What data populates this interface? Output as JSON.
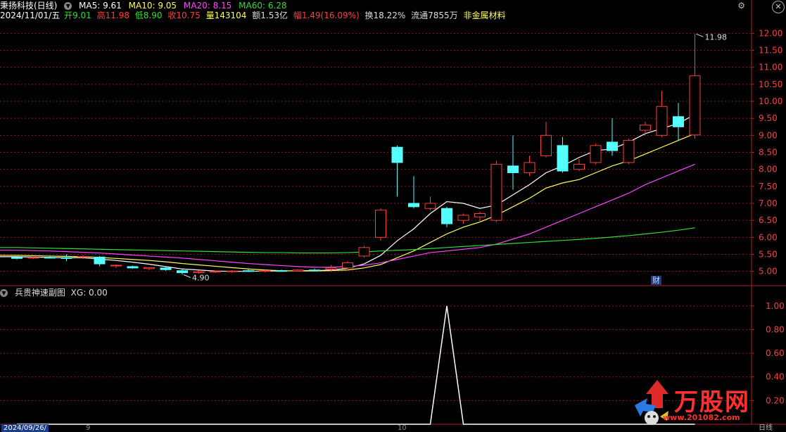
{
  "header": {
    "title": "秉扬科技(日线)",
    "ma": [
      {
        "label": "MA5: 9.61",
        "color": "#ffffff"
      },
      {
        "label": "MA10: 9.05",
        "color": "#ffff55"
      },
      {
        "label": "MA20: 8.15",
        "color": "#ff44ff"
      },
      {
        "label": "MA60: 6.28",
        "color": "#33dd33"
      }
    ]
  },
  "info": {
    "date": "2024/11/01/五",
    "open_label": "开",
    "open": "9.01",
    "high_label": "高",
    "high": "11.98",
    "low_label": "低",
    "low": "8.90",
    "close_label": "收",
    "close": "10.75",
    "vol_label": "量",
    "vol": "143104",
    "amt_label": "额",
    "amt": "1.53亿",
    "chg_label": "幅",
    "chg": "1.49(16.09%)",
    "turnover": "换18.22%",
    "float": "流通7855万",
    "sector": "非金属材料"
  },
  "sub": {
    "title": "兵贵神速副图",
    "xg": "XG: 0.00"
  },
  "badge": "财",
  "bottom": {
    "date": "2024/09/26/",
    "mark1": "9",
    "mark2": "10",
    "right": "日线"
  },
  "watermark": {
    "text": "万股网",
    "url": "www.201082.com"
  },
  "colors": {
    "up": "#ff3d3d",
    "down": "#54ffff",
    "ma5": "#ffffff",
    "ma10": "#ffff55",
    "ma20": "#ff44ff",
    "ma60": "#33dd33",
    "grid": "#8b1a1a"
  },
  "chart_data": [
    {
      "type": "candlestick",
      "title": "秉扬科技(日线)",
      "ylim": [
        4.6,
        12.4
      ],
      "y_ticks": [
        "12.00",
        "11.50",
        "11.00",
        "10.50",
        "10.00",
        "9.50",
        "9.00",
        "8.50",
        "8.00",
        "7.50",
        "7.00",
        "6.50",
        "6.00",
        "5.50",
        "5.00"
      ],
      "annotations": [
        {
          "text": "11.98",
          "value": 11.98
        },
        {
          "text": "4.90",
          "value": 4.9
        }
      ],
      "candles": [
        {
          "o": 5.41,
          "h": 5.45,
          "l": 5.35,
          "c": 5.38
        },
        {
          "o": 5.4,
          "h": 5.44,
          "l": 5.36,
          "c": 5.41
        },
        {
          "o": 5.41,
          "h": 5.46,
          "l": 5.38,
          "c": 5.4
        },
        {
          "o": 5.4,
          "h": 5.5,
          "l": 5.3,
          "c": 5.38
        },
        {
          "o": 5.42,
          "h": 5.48,
          "l": 5.36,
          "c": 5.44
        },
        {
          "o": 5.42,
          "h": 5.45,
          "l": 5.15,
          "c": 5.22
        },
        {
          "o": 5.16,
          "h": 5.2,
          "l": 5.1,
          "c": 5.18
        },
        {
          "o": 5.14,
          "h": 5.17,
          "l": 5.08,
          "c": 5.1
        },
        {
          "o": 5.08,
          "h": 5.12,
          "l": 5.04,
          "c": 5.11
        },
        {
          "o": 5.1,
          "h": 5.12,
          "l": 5.02,
          "c": 5.05
        },
        {
          "o": 5.02,
          "h": 5.06,
          "l": 4.9,
          "c": 4.96
        },
        {
          "o": 4.96,
          "h": 5.02,
          "l": 4.93,
          "c": 4.99
        },
        {
          "o": 4.99,
          "h": 5.02,
          "l": 4.95,
          "c": 5.0
        },
        {
          "o": 5.0,
          "h": 5.03,
          "l": 4.96,
          "c": 5.01
        },
        {
          "o": 5.02,
          "h": 5.06,
          "l": 4.98,
          "c": 5.0
        },
        {
          "o": 5.0,
          "h": 5.04,
          "l": 4.97,
          "c": 5.02
        },
        {
          "o": 5.02,
          "h": 5.05,
          "l": 4.99,
          "c": 5.01
        },
        {
          "o": 5.01,
          "h": 5.06,
          "l": 4.99,
          "c": 5.04
        },
        {
          "o": 5.04,
          "h": 5.08,
          "l": 5.0,
          "c": 5.03
        },
        {
          "o": 5.06,
          "h": 5.18,
          "l": 5.0,
          "c": 5.1
        },
        {
          "o": 5.1,
          "h": 5.3,
          "l": 5.08,
          "c": 5.25
        },
        {
          "o": 5.45,
          "h": 5.75,
          "l": 5.4,
          "c": 5.7
        },
        {
          "o": 6.0,
          "h": 6.85,
          "l": 5.9,
          "c": 6.8
        },
        {
          "o": 8.65,
          "h": 8.7,
          "l": 7.2,
          "c": 8.2
        },
        {
          "o": 7.0,
          "h": 7.8,
          "l": 6.85,
          "c": 6.9
        },
        {
          "o": 6.85,
          "h": 7.2,
          "l": 6.8,
          "c": 7.0
        },
        {
          "o": 6.85,
          "h": 6.9,
          "l": 6.3,
          "c": 6.4
        },
        {
          "o": 6.5,
          "h": 6.7,
          "l": 6.4,
          "c": 6.65
        },
        {
          "o": 6.6,
          "h": 6.75,
          "l": 6.45,
          "c": 6.7
        },
        {
          "o": 6.5,
          "h": 8.25,
          "l": 6.45,
          "c": 8.15
        },
        {
          "o": 8.1,
          "h": 9.0,
          "l": 7.4,
          "c": 7.9
        },
        {
          "o": 7.9,
          "h": 8.4,
          "l": 7.8,
          "c": 8.2
        },
        {
          "o": 8.4,
          "h": 9.4,
          "l": 8.35,
          "c": 9.0
        },
        {
          "o": 8.7,
          "h": 8.95,
          "l": 7.9,
          "c": 7.95
        },
        {
          "o": 8.0,
          "h": 8.3,
          "l": 7.95,
          "c": 8.15
        },
        {
          "o": 8.2,
          "h": 8.75,
          "l": 8.15,
          "c": 8.7
        },
        {
          "o": 8.8,
          "h": 9.5,
          "l": 8.4,
          "c": 8.55
        },
        {
          "o": 8.2,
          "h": 8.9,
          "l": 8.15,
          "c": 8.85
        },
        {
          "o": 9.15,
          "h": 9.4,
          "l": 9.0,
          "c": 9.3
        },
        {
          "o": 9.0,
          "h": 10.3,
          "l": 8.95,
          "c": 9.85
        },
        {
          "o": 9.55,
          "h": 9.95,
          "l": 8.85,
          "c": 9.25
        },
        {
          "o": 9.01,
          "h": 11.98,
          "l": 8.9,
          "c": 10.75
        }
      ],
      "ma_series": [
        {
          "name": "MA5",
          "values": [
            5.43,
            5.42,
            5.41,
            5.4,
            5.4,
            5.36,
            5.32,
            5.27,
            5.21,
            5.14,
            5.07,
            5.04,
            5.01,
            5.0,
            5.0,
            5.01,
            5.01,
            5.02,
            5.02,
            5.04,
            5.09,
            5.22,
            5.47,
            5.9,
            6.25,
            6.7,
            7.05,
            7.0,
            6.85,
            6.95,
            7.25,
            7.55,
            7.9,
            8.1,
            8.35,
            8.55,
            8.6,
            8.8,
            9.05,
            9.2,
            9.35,
            9.61
          ]
        },
        {
          "name": "MA10",
          "values": [
            5.47,
            5.46,
            5.45,
            5.44,
            5.43,
            5.41,
            5.38,
            5.35,
            5.32,
            5.28,
            5.23,
            5.19,
            5.15,
            5.11,
            5.07,
            5.04,
            5.02,
            5.01,
            5.01,
            5.02,
            5.04,
            5.1,
            5.2,
            5.4,
            5.6,
            5.85,
            6.1,
            6.3,
            6.45,
            6.65,
            6.9,
            7.15,
            7.45,
            7.6,
            7.7,
            7.9,
            8.1,
            8.25,
            8.45,
            8.65,
            8.85,
            9.05
          ]
        },
        {
          "name": "MA20",
          "values": [
            5.62,
            5.61,
            5.6,
            5.58,
            5.56,
            5.54,
            5.51,
            5.48,
            5.45,
            5.42,
            5.39,
            5.35,
            5.31,
            5.27,
            5.23,
            5.2,
            5.17,
            5.14,
            5.12,
            5.12,
            5.14,
            5.18,
            5.25,
            5.35,
            5.45,
            5.55,
            5.6,
            5.65,
            5.7,
            5.8,
            5.95,
            6.1,
            6.3,
            6.5,
            6.7,
            6.9,
            7.1,
            7.3,
            7.55,
            7.75,
            7.95,
            8.15
          ]
        },
        {
          "name": "MA60",
          "values": [
            5.7,
            5.69,
            5.68,
            5.67,
            5.66,
            5.65,
            5.64,
            5.63,
            5.62,
            5.61,
            5.6,
            5.59,
            5.58,
            5.57,
            5.56,
            5.55,
            5.55,
            5.54,
            5.54,
            5.54,
            5.55,
            5.57,
            5.6,
            5.62,
            5.64,
            5.67,
            5.7,
            5.73,
            5.76,
            5.79,
            5.82,
            5.85,
            5.88,
            5.91,
            5.94,
            5.97,
            6.01,
            6.05,
            6.1,
            6.15,
            6.21,
            6.28
          ]
        }
      ]
    },
    {
      "type": "line",
      "title": "兵贵神速副图",
      "ylim": [
        0,
        1.1
      ],
      "y_ticks": [
        "1.00",
        "0.80",
        "0.60",
        "0.40",
        "0.20"
      ],
      "series": [
        {
          "name": "XG",
          "values": [
            0,
            0,
            0,
            0,
            0,
            0,
            0,
            0,
            0,
            0,
            0,
            0,
            0,
            0,
            0,
            0,
            0,
            0,
            0,
            0,
            0,
            0,
            0,
            0,
            0,
            0,
            1,
            0,
            0,
            0,
            0,
            0,
            0,
            0,
            0,
            0,
            0,
            0,
            0,
            0,
            0,
            0
          ]
        }
      ]
    }
  ]
}
